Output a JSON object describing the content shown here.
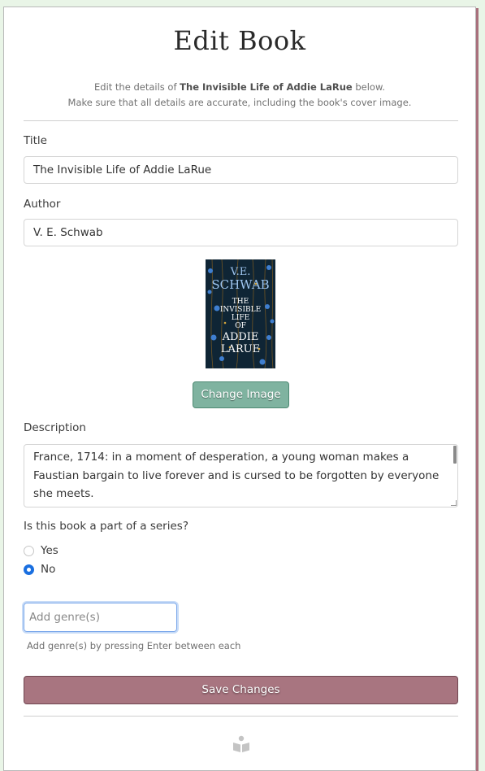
{
  "page": {
    "title": "Edit Book",
    "intro_prefix": "Edit the details of ",
    "intro_book": "The Invisible Life of Addie LaRue",
    "intro_suffix": " below.",
    "intro_line2": "Make sure that all details are accurate, including the book's cover image."
  },
  "form": {
    "title_label": "Title",
    "title_value": "The Invisible Life of Addie LaRue",
    "author_label": "Author",
    "author_value": "V. E. Schwab",
    "cover": {
      "author_line1": "V.E.",
      "author_line2": "SCHWAB",
      "title_line1": "THE",
      "title_line2": "INVISIBLE",
      "title_line3": "LIFE",
      "title_line4": "OF",
      "title_line5": "ADDIE",
      "title_line6": "LARUE"
    },
    "change_image_label": "Change Image",
    "description_label": "Description",
    "description_value": "France, 1714: in a moment of desperation, a young woman makes a Faustian bargain to live forever and is cursed to be forgotten by everyone she meets.",
    "series_question": "Is this book a part of a series?",
    "series_options": [
      {
        "label": "Yes",
        "checked": false
      },
      {
        "label": "No",
        "checked": true
      }
    ],
    "genre_placeholder": "Add genre(s)",
    "genre_hint": "Add genre(s) by pressing Enter between each",
    "save_label": "Save Changes"
  },
  "colors": {
    "background": "#e9f5e7",
    "change_button": "#7fb3a0",
    "save_button": "#a87580",
    "radio_accent": "#1a6fe0"
  },
  "icons": {
    "footer": "book-reader-icon"
  }
}
